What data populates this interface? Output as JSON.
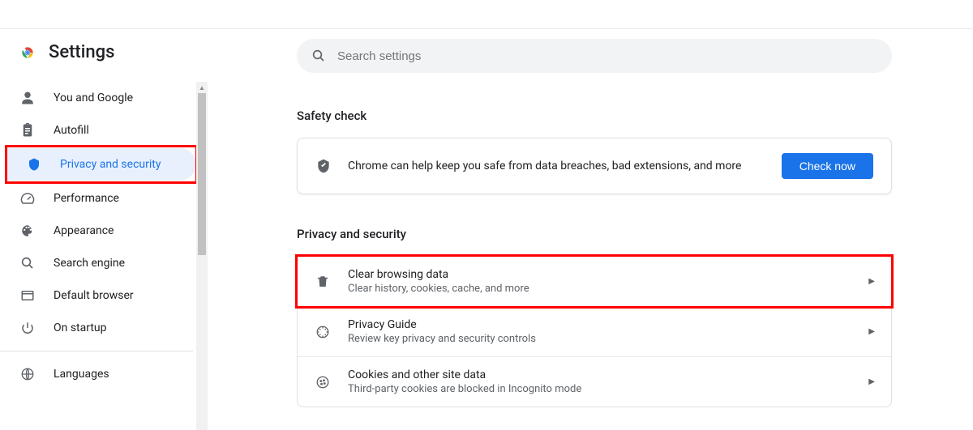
{
  "brand": {
    "title": "Settings"
  },
  "search": {
    "placeholder": "Search settings"
  },
  "sidebar": {
    "items": [
      {
        "label": "You and Google"
      },
      {
        "label": "Autofill"
      },
      {
        "label": "Privacy and security"
      },
      {
        "label": "Performance"
      },
      {
        "label": "Appearance"
      },
      {
        "label": "Search engine"
      },
      {
        "label": "Default browser"
      },
      {
        "label": "On startup"
      },
      {
        "label": "Languages"
      }
    ]
  },
  "sections": {
    "safety_title": "Safety check",
    "safety_text": "Chrome can help keep you safe from data breaches, bad extensions, and more",
    "check_now": "Check now",
    "privacy_title": "Privacy and security",
    "rows": [
      {
        "title": "Clear browsing data",
        "sub": "Clear history, cookies, cache, and more"
      },
      {
        "title": "Privacy Guide",
        "sub": "Review key privacy and security controls"
      },
      {
        "title": "Cookies and other site data",
        "sub": "Third-party cookies are blocked in Incognito mode"
      }
    ]
  }
}
